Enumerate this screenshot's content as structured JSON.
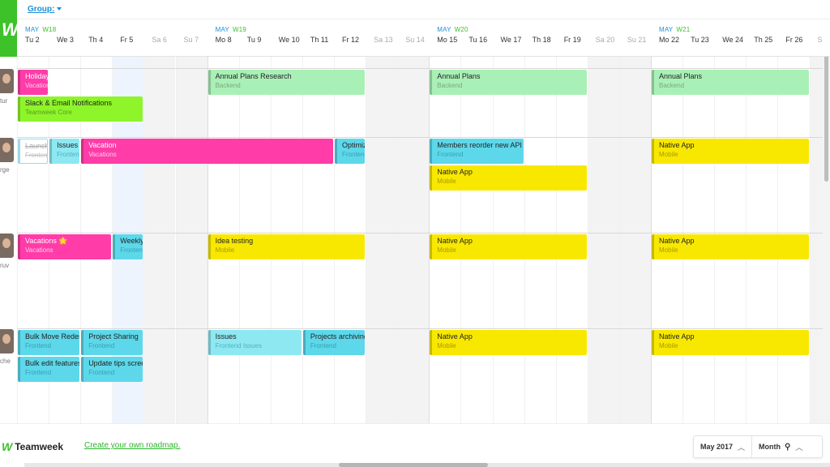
{
  "group_filter": {
    "label": "Group:"
  },
  "weeks": [
    {
      "month": "MAY",
      "week": "W18"
    },
    {
      "month": "MAY",
      "week": "W19"
    },
    {
      "month": "MAY",
      "week": "W20"
    },
    {
      "month": "MAY",
      "week": "W21"
    }
  ],
  "days": [
    "Tu 2",
    "We 3",
    "Th 4",
    "Fr 5",
    "Sa 6",
    "Su 7",
    "Mo 8",
    "Tu 9",
    "We 10",
    "Th 11",
    "Fr 12",
    "Sa 13",
    "Su 14",
    "Mo 15",
    "Tu 16",
    "We 17",
    "Th 18",
    "Fr 19",
    "Sa 20",
    "Su 21",
    "Mo 22",
    "Tu 23",
    "We 24",
    "Th 25",
    "Fr 26",
    "S"
  ],
  "weekend_days": [
    "Sa 6",
    "Su 7",
    "Sa 13",
    "Su 14",
    "Sa 20",
    "Su 21",
    "S"
  ],
  "today": "Fr 5",
  "people": [
    {
      "name": "tur"
    },
    {
      "name": "rge"
    },
    {
      "name": "ruv"
    },
    {
      "name": "che"
    }
  ],
  "tasks": [
    {
      "person": "tur",
      "title": "Holiday",
      "project": "Vacation",
      "color": "#ff3ca8",
      "style": "pink"
    },
    {
      "person": "tur",
      "title": "Slack & Email Notifications",
      "project": "Teamweek Core",
      "color": "#8ef52a",
      "style": "lime"
    },
    {
      "person": "tur",
      "title": "Annual Plans Research",
      "project": "Backend",
      "color": "#a9f0b6",
      "style": "lightgreen"
    },
    {
      "person": "tur",
      "title": "Annual Plans",
      "project": "Backend",
      "color": "#a9f0b6",
      "style": "lightgreen"
    },
    {
      "person": "tur",
      "title": "Annual Plans",
      "project": "Backend",
      "color": "#a9f0b6",
      "style": "lightgreen"
    },
    {
      "person": "rge",
      "title": "Launch",
      "project": "Fronten",
      "color": "#ffffff",
      "style": "outline"
    },
    {
      "person": "rge",
      "title": "Issues",
      "project": "Fronten",
      "color": "#8ee8f2",
      "style": "lightcyan"
    },
    {
      "person": "rge",
      "title": "Vacation",
      "project": "Vacations",
      "color": "#ff3ca8",
      "style": "pink"
    },
    {
      "person": "rge",
      "title": "Optimiz",
      "project": "Fronten",
      "color": "#5dd8ea",
      "style": "cyan"
    },
    {
      "person": "rge",
      "title": "Members reorder new API",
      "project": "Frontend",
      "color": "#5dd8ea",
      "style": "cyan"
    },
    {
      "person": "rge",
      "title": "Native App",
      "project": "Mobile",
      "color": "#f8e800",
      "style": "yellow"
    },
    {
      "person": "rge",
      "title": "Native App",
      "project": "Mobile",
      "color": "#f8e800",
      "style": "yellow"
    },
    {
      "person": "ruv",
      "title": "Vacations 🌟",
      "project": "Vacations",
      "color": "#ff3ca8",
      "style": "pink"
    },
    {
      "person": "ruv",
      "title": "Weekly",
      "project": "Fronten",
      "color": "#5dd8ea",
      "style": "cyan"
    },
    {
      "person": "ruv",
      "title": "Idea testing",
      "project": "Mobile",
      "color": "#f8e800",
      "style": "yellow"
    },
    {
      "person": "ruv",
      "title": "Native App",
      "project": "Mobile",
      "color": "#f8e800",
      "style": "yellow"
    },
    {
      "person": "ruv",
      "title": "Native App",
      "project": "Mobile",
      "color": "#f8e800",
      "style": "yellow"
    },
    {
      "person": "che",
      "title": "Bulk Move Redes",
      "project": "Frontend",
      "color": "#5dd8ea",
      "style": "cyan"
    },
    {
      "person": "che",
      "title": "Project Sharing",
      "project": "Frontend",
      "color": "#5dd8ea",
      "style": "cyan"
    },
    {
      "person": "che",
      "title": "Bulk edit features",
      "project": "Frontend",
      "color": "#5dd8ea",
      "style": "cyan"
    },
    {
      "person": "che",
      "title": "Update tips scree",
      "project": "Frontend",
      "color": "#5dd8ea",
      "style": "cyan"
    },
    {
      "person": "che",
      "title": "Issues",
      "project": "Frontend Issues",
      "color": "#8ee8f2",
      "style": "lightcyan"
    },
    {
      "person": "che",
      "title": "Projects archiving",
      "project": "Frontend",
      "color": "#5dd8ea",
      "style": "cyan"
    },
    {
      "person": "che",
      "title": "Native App",
      "project": "Mobile",
      "color": "#f8e800",
      "style": "yellow"
    },
    {
      "person": "che",
      "title": "Native App",
      "project": "Mobile",
      "color": "#f8e800",
      "style": "yellow"
    }
  ],
  "footer": {
    "brand": "Teamweek",
    "create_link": "Create your own roadmap.",
    "period": "May 2017",
    "zoom": "Month"
  },
  "colors": {
    "brand_green": "#3ec22a",
    "link_blue": "#1a8fd6"
  }
}
